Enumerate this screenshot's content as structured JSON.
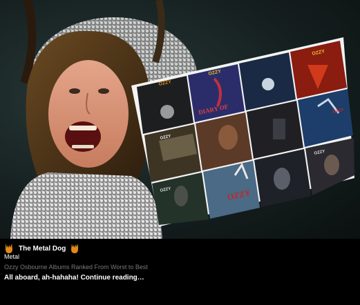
{
  "post": {
    "author": "The Metal Dog",
    "category": "Metal",
    "title": "Ozzy Osbourne Albums Ranked From Worst to Best",
    "teaser": "All aboard, ah-hahaha! Continue reading…"
  },
  "hero": {
    "image_alt": "Ozzy Osbourne album covers collage",
    "album_labels": [
      "OZZY OSBOURNE",
      "DIARY OF",
      "OZZY"
    ]
  },
  "colors": {
    "accent_orange": "#e08a1a",
    "muted_title": "#7a7a7a",
    "background": "#000000"
  },
  "icons": {
    "brand_left": "devil-horns-icon",
    "brand_right": "devil-horns-icon"
  }
}
